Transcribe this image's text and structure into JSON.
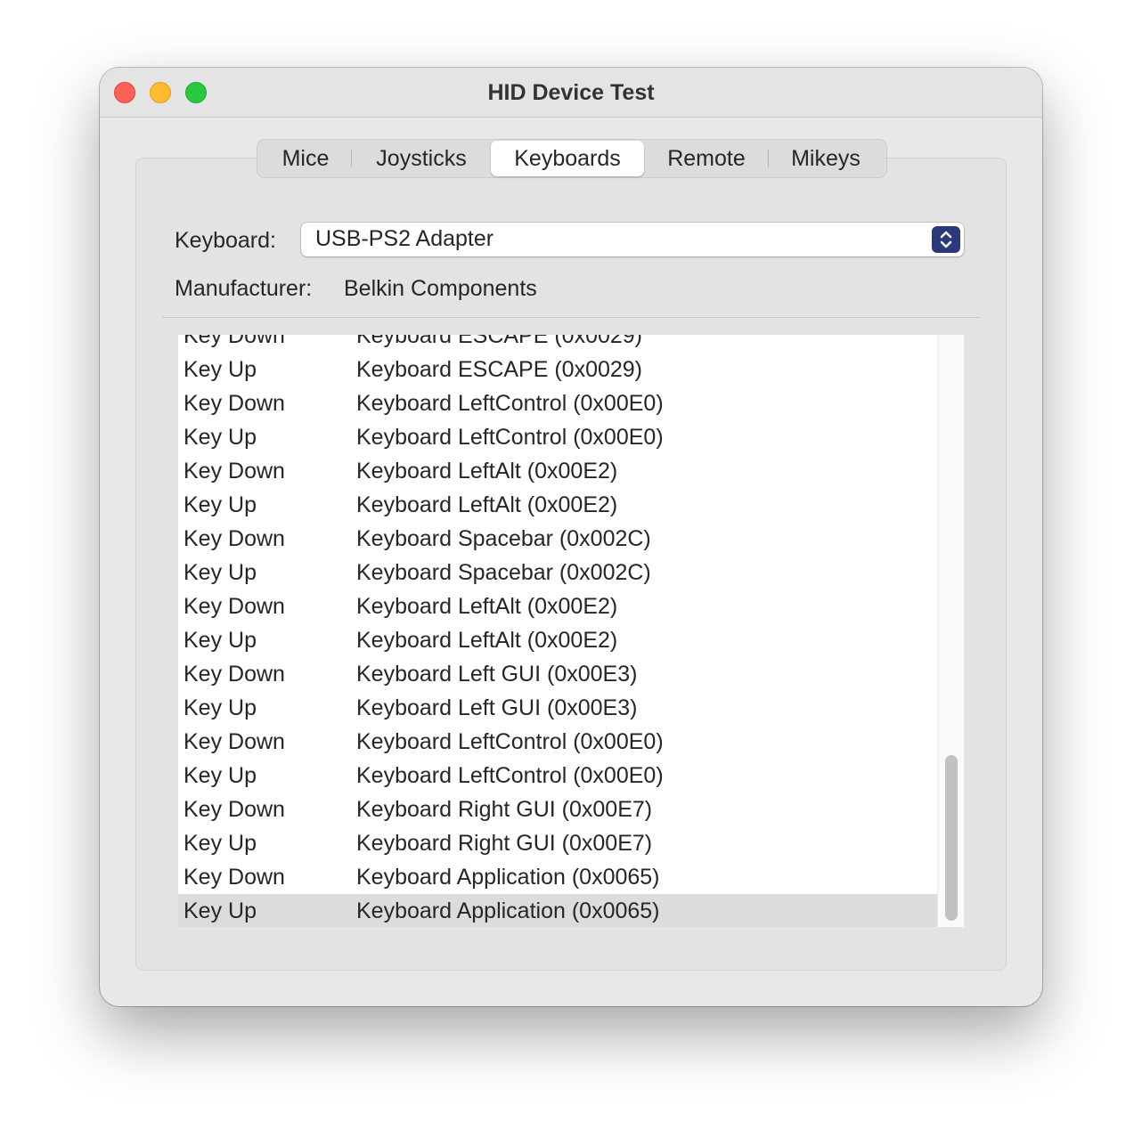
{
  "window": {
    "title": "HID Device Test"
  },
  "tabs": [
    {
      "label": "Mice",
      "active": false
    },
    {
      "label": "Joysticks",
      "active": false
    },
    {
      "label": "Keyboards",
      "active": true
    },
    {
      "label": "Remote",
      "active": false
    },
    {
      "label": "Mikeys",
      "active": false
    }
  ],
  "keyboard": {
    "label": "Keyboard:",
    "selected": "USB-PS2 Adapter"
  },
  "manufacturer": {
    "label": "Manufacturer:",
    "value": "Belkin Components"
  },
  "events": [
    {
      "type": "Key Down",
      "key": "Keyboard ESCAPE (0x0029)"
    },
    {
      "type": "Key Up",
      "key": "Keyboard ESCAPE (0x0029)"
    },
    {
      "type": "Key Down",
      "key": "Keyboard LeftControl (0x00E0)"
    },
    {
      "type": "Key Up",
      "key": "Keyboard LeftControl (0x00E0)"
    },
    {
      "type": "Key Down",
      "key": "Keyboard LeftAlt (0x00E2)"
    },
    {
      "type": "Key Up",
      "key": "Keyboard LeftAlt (0x00E2)"
    },
    {
      "type": "Key Down",
      "key": "Keyboard Spacebar (0x002C)"
    },
    {
      "type": "Key Up",
      "key": "Keyboard Spacebar (0x002C)"
    },
    {
      "type": "Key Down",
      "key": "Keyboard LeftAlt (0x00E2)"
    },
    {
      "type": "Key Up",
      "key": "Keyboard LeftAlt (0x00E2)"
    },
    {
      "type": "Key Down",
      "key": "Keyboard Left GUI (0x00E3)"
    },
    {
      "type": "Key Up",
      "key": "Keyboard Left GUI (0x00E3)"
    },
    {
      "type": "Key Down",
      "key": "Keyboard LeftControl (0x00E0)"
    },
    {
      "type": "Key Up",
      "key": "Keyboard LeftControl (0x00E0)"
    },
    {
      "type": "Key Down",
      "key": "Keyboard Right GUI (0x00E7)"
    },
    {
      "type": "Key Up",
      "key": "Keyboard Right GUI (0x00E7)"
    },
    {
      "type": "Key Down",
      "key": "Keyboard Application (0x0065)"
    },
    {
      "type": "Key Up",
      "key": "Keyboard Application (0x0065)",
      "selected": true
    }
  ],
  "colors": {
    "close": "#fe5f57",
    "minimize": "#febc2e",
    "maximize": "#28c840",
    "popup_accent": "#2a3a78",
    "selected_row": "#dcdcdc"
  }
}
